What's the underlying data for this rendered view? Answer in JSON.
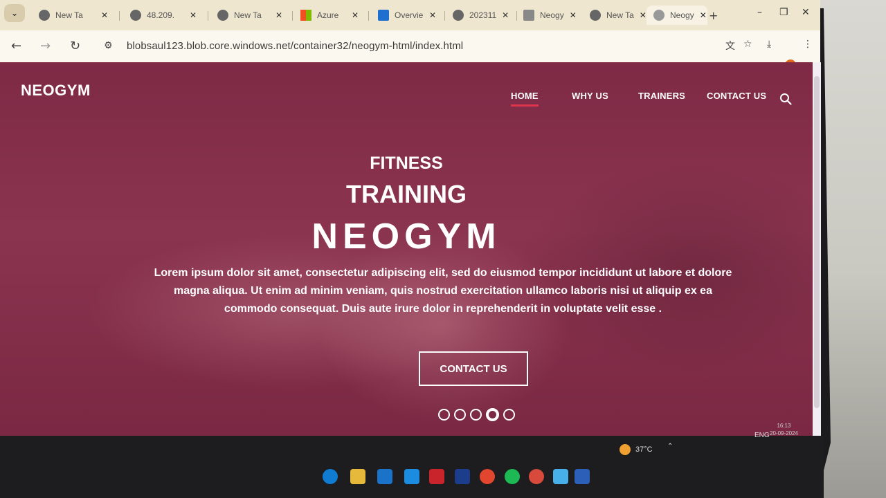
{
  "browser": {
    "tabs": [
      {
        "title": "New Ta",
        "icon": "chrome-icon"
      },
      {
        "title": "48.209.",
        "icon": "globe-icon"
      },
      {
        "title": "New Ta",
        "icon": "chrome-icon"
      },
      {
        "title": "Azure",
        "icon": "microsoft-icon"
      },
      {
        "title": "Overvie",
        "icon": "azure-icon"
      },
      {
        "title": "202311",
        "icon": "globe-icon"
      },
      {
        "title": "Neogy",
        "icon": "page-icon"
      },
      {
        "title": "New Ta",
        "icon": "chrome-icon"
      },
      {
        "title": "Neogy",
        "icon": "loading-icon"
      }
    ],
    "address": "blobsaul123.blob.core.windows.net/container32/neogym-html/index.html"
  },
  "site": {
    "logo": "NEOGYM",
    "nav": [
      "HOME",
      "WHY US",
      "TRAINERS",
      "CONTACT US"
    ],
    "active_nav": "HOME",
    "hero": {
      "line1": "FITNESS",
      "line2": "TRAINING",
      "line3": "NEOGYM",
      "lead": "Lorem ipsum dolor sit amet, consectetur adipiscing elit, sed do eiusmod tempor incididunt ut labore et dolore magna aliqua. Ut enim ad minim veniam, quis nostrud exercitation ullamco laboris nisi ut aliquip ex ea commodo consequat. Duis aute irure dolor in reprehenderit in voluptate velit esse .",
      "cta": "CONTACT US"
    },
    "carousel": {
      "count": 5,
      "active_index": 4
    }
  },
  "taskbar": {
    "temperature": "37°C",
    "lang": "ENG",
    "time": "16:13",
    "date": "20-09-2024"
  },
  "colors": {
    "hero_overlay": "#8b3450",
    "nav_active_underline": "#e0334e",
    "tab_strip": "#efe6cf"
  }
}
